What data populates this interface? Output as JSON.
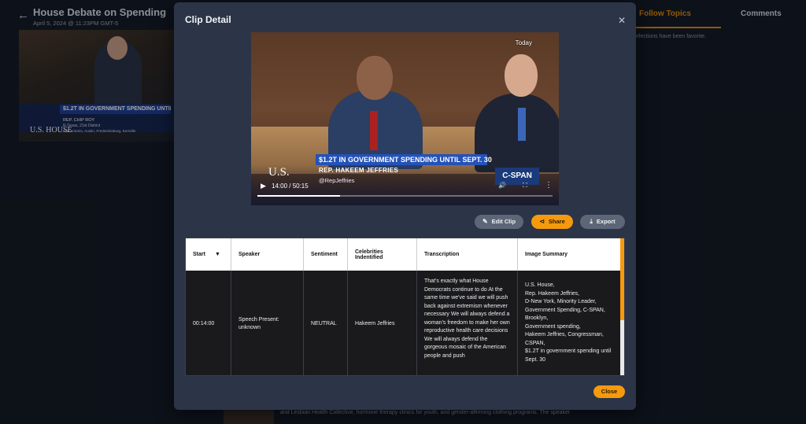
{
  "background": {
    "page_title": "House Debate on Spending",
    "page_subtitle": "April 5, 2024 @ 11:23PM GMT-5",
    "thumbnail": {
      "headline": "$1.2T IN GOVERNMENT SPENDING UNTIL SEPT. 30",
      "name": "REP. CHIP ROY",
      "district": "R-Texas, 21st District",
      "cities": "San Antonio, Austin, Fredericksburg, Kerrville",
      "logo": "U.S. HOUSE"
    },
    "tabs": [
      {
        "label": "Follow Topics",
        "active": true
      },
      {
        "label": "Comments",
        "active": false
      }
    ],
    "right_note": "elections have been favorite.",
    "bottom_text": "and Lesbian Health Collective, hormone therapy clinics for youth, and gender-affirming clothing programs. The speaker"
  },
  "modal": {
    "title": "Clip Detail",
    "close_icon": "close-icon",
    "video": {
      "today_label": "Today",
      "headline": "$1.2T IN GOVERNMENT SPENDING UNTIL SEPT. 30",
      "name": "REP. HAKEEM JEFFRIES",
      "handle": "@RepJeffries",
      "logo": "U.S.",
      "cspan": "C-SPAN",
      "time": "14:00 / 50:15",
      "progress": 0.28
    },
    "buttons": {
      "edit": "Edit Clip",
      "share": "Share",
      "export": "Export",
      "close": "Close"
    },
    "table": {
      "headers": [
        "Start",
        "Speaker",
        "Sentiment",
        "Celebrities Indentified",
        "Transcription",
        "Image Summary"
      ],
      "rows": [
        {
          "start": "00:14:00",
          "speaker": "Speech Present: unknown",
          "sentiment": "NEUTRAL",
          "celebrities": "Hakeem Jeffries",
          "transcription": "That's exactly what House Democrats continue to do At the same time we've said we will push back against extremism whenever necessary We will always defend a woman's freedom to make her own reproductive health care decisions We will always defend the gorgeous mosaic of the American people and push",
          "image_summary": "U.S. House,\nRep. Hakeem Jeffries,\nD-New York, Minority Leader,\nGovernment Spending, C-SPAN,\nBrooklyn,\nGovernment spending,\nHakeem Jeffries, Congressman,\nCSPAN,\n$1.2T in government spending until Sept. 30"
        }
      ]
    },
    "accent_color": "#f59a0e"
  }
}
